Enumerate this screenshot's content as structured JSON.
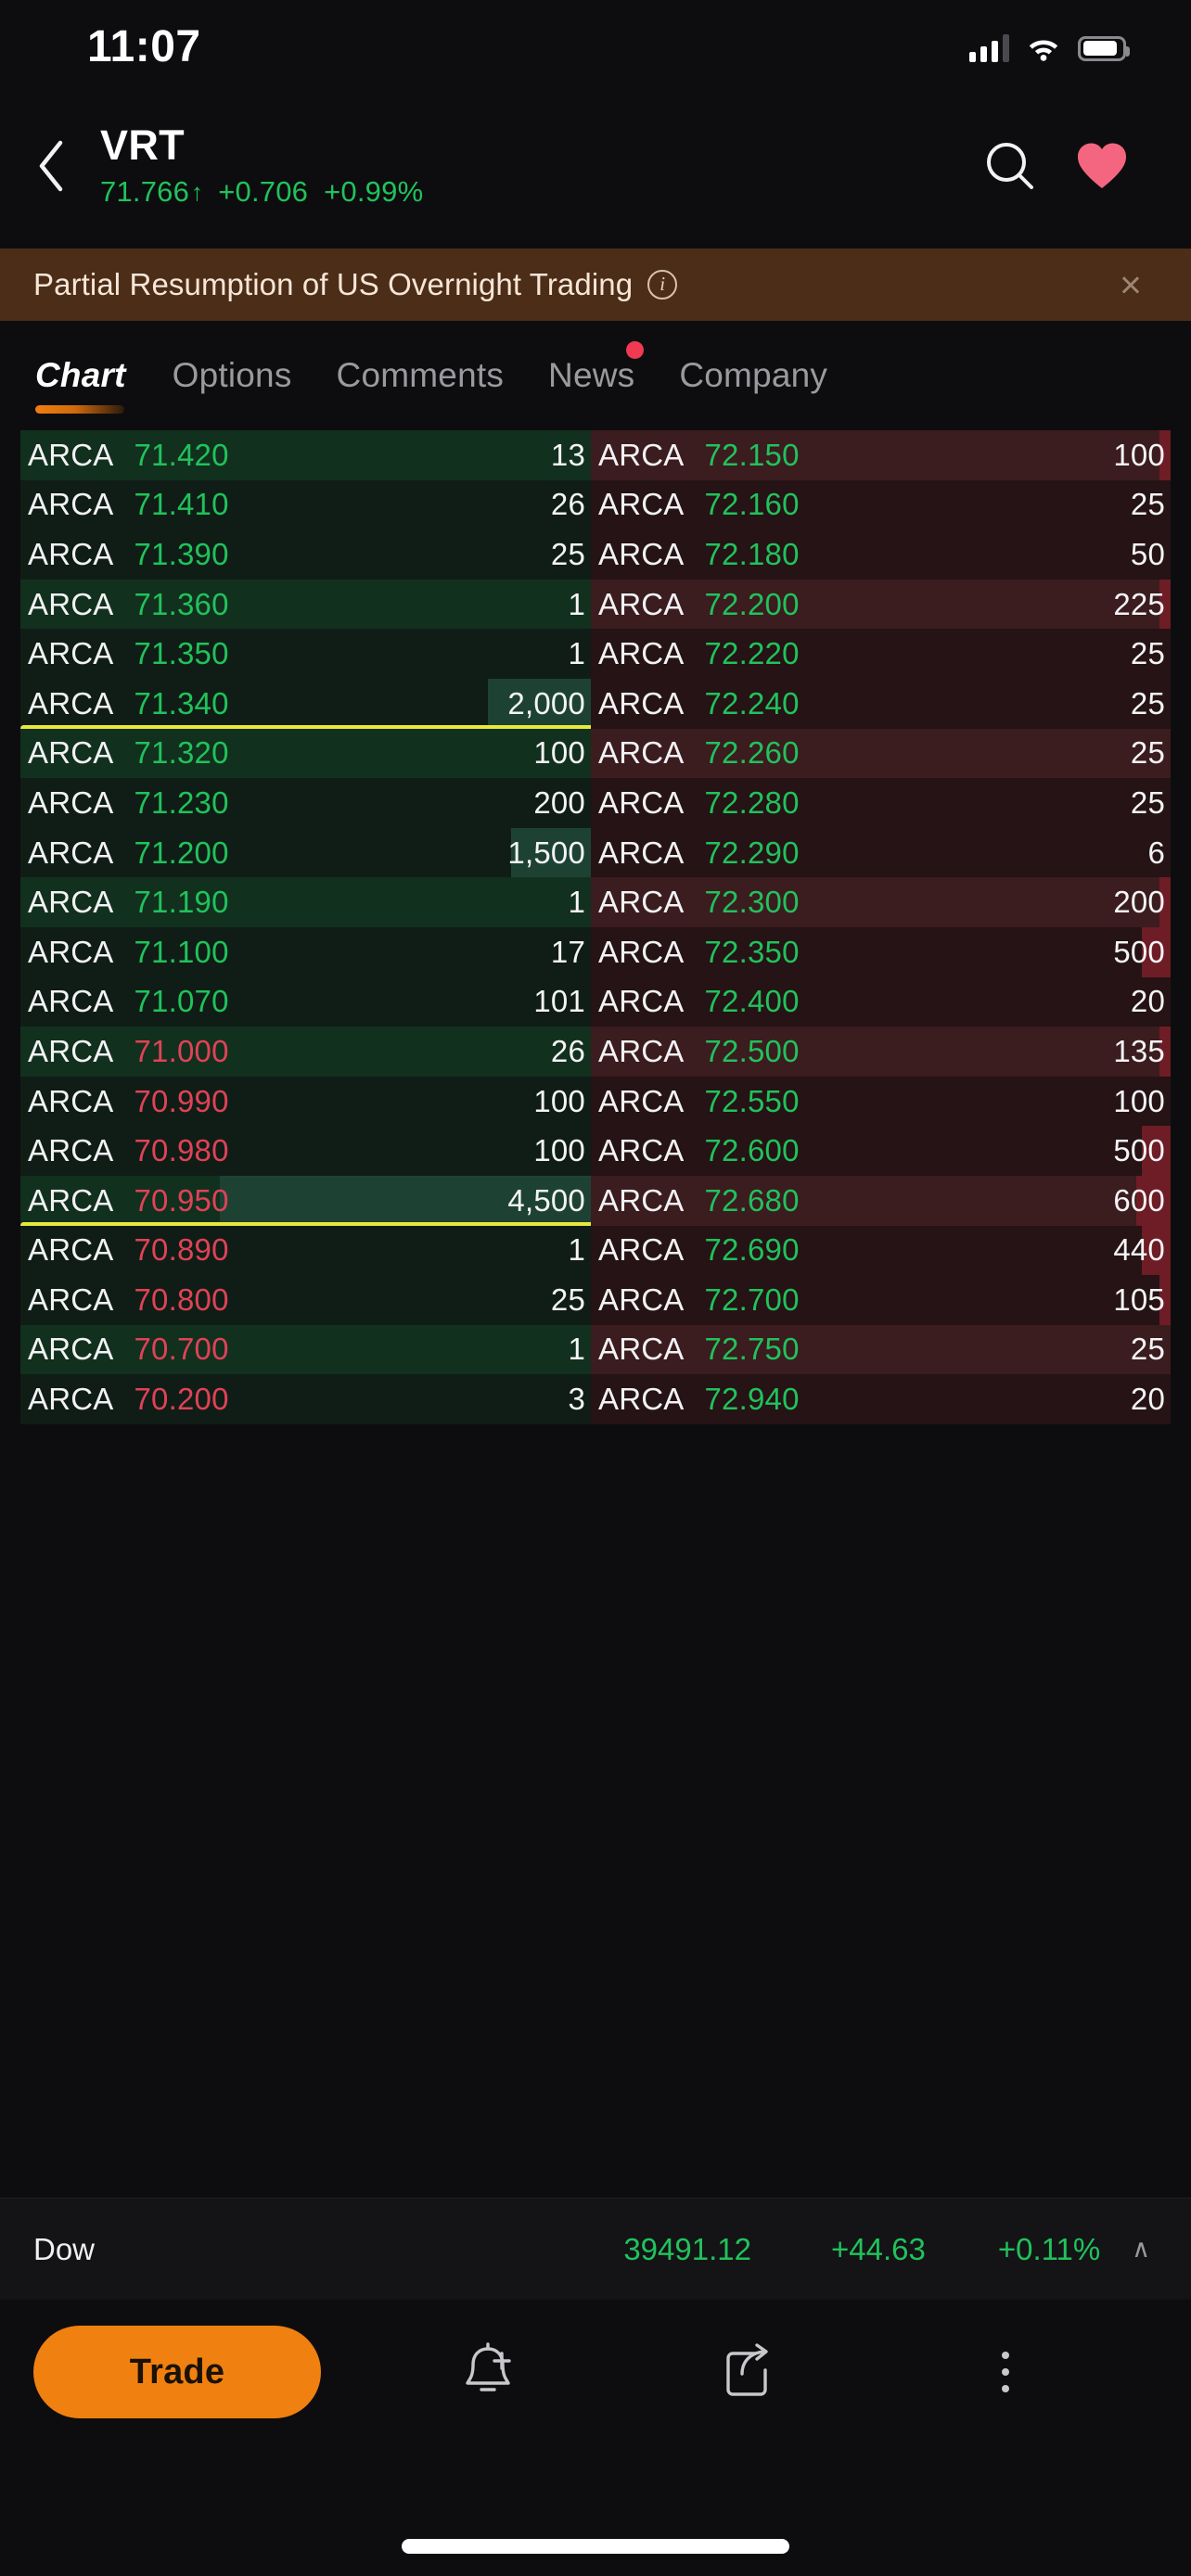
{
  "status_bar": {
    "time": "11:07",
    "signal_icon": "cellular-bars-icon",
    "wifi_icon": "wifi-icon",
    "battery_icon": "battery-icon"
  },
  "header": {
    "back_icon": "back-chevron-icon",
    "symbol": "VRT",
    "last_price": "71.766",
    "arrow": "↑",
    "change": "+0.706",
    "change_percent": "+0.99%",
    "search_icon": "search-icon",
    "favorite_icon": "heart-icon",
    "up_color": "#21c25c"
  },
  "banner": {
    "text": "Partial Resumption of US Overnight Trading",
    "info_icon": "info-icon",
    "info_glyph": "i",
    "close_icon": "close-icon",
    "close_glyph": "×",
    "background": "#4c2d18"
  },
  "tabs": {
    "items": [
      {
        "label": "Chart",
        "active": true,
        "badge": false
      },
      {
        "label": "Options",
        "active": false,
        "badge": false
      },
      {
        "label": "Comments",
        "active": false,
        "badge": false
      },
      {
        "label": "News",
        "active": false,
        "badge": true
      },
      {
        "label": "Company",
        "active": false,
        "badge": false
      }
    ],
    "active_underline_color": "#f07d10",
    "badge_color": "#f03a52"
  },
  "order_book": {
    "bids": [
      {
        "mm": "ARCA",
        "price": "71.420",
        "size": "13",
        "dir": "up",
        "depth_pct": 0,
        "shade": "a"
      },
      {
        "mm": "ARCA",
        "price": "71.410",
        "size": "26",
        "dir": "up",
        "depth_pct": 0,
        "shade": "b"
      },
      {
        "mm": "ARCA",
        "price": "71.390",
        "size": "25",
        "dir": "up",
        "depth_pct": 0,
        "shade": "b"
      },
      {
        "mm": "ARCA",
        "price": "71.360",
        "size": "1",
        "dir": "up",
        "depth_pct": 0,
        "shade": "a"
      },
      {
        "mm": "ARCA",
        "price": "71.350",
        "size": "1",
        "dir": "up",
        "depth_pct": 0,
        "shade": "b"
      },
      {
        "mm": "ARCA",
        "price": "71.340",
        "size": "2,000",
        "dir": "up",
        "depth_pct": 18,
        "shade": "b",
        "divider": true
      },
      {
        "mm": "ARCA",
        "price": "71.320",
        "size": "100",
        "dir": "up",
        "depth_pct": 0,
        "shade": "a"
      },
      {
        "mm": "ARCA",
        "price": "71.230",
        "size": "200",
        "dir": "up",
        "depth_pct": 0,
        "shade": "b"
      },
      {
        "mm": "ARCA",
        "price": "71.200",
        "size": "1,500",
        "dir": "up",
        "depth_pct": 14,
        "shade": "b"
      },
      {
        "mm": "ARCA",
        "price": "71.190",
        "size": "1",
        "dir": "up",
        "depth_pct": 0,
        "shade": "a"
      },
      {
        "mm": "ARCA",
        "price": "71.100",
        "size": "17",
        "dir": "up",
        "depth_pct": 0,
        "shade": "b"
      },
      {
        "mm": "ARCA",
        "price": "71.070",
        "size": "101",
        "dir": "up",
        "depth_pct": 0,
        "shade": "b"
      },
      {
        "mm": "ARCA",
        "price": "71.000",
        "size": "26",
        "dir": "down",
        "depth_pct": 0,
        "shade": "a"
      },
      {
        "mm": "ARCA",
        "price": "70.990",
        "size": "100",
        "dir": "down",
        "depth_pct": 0,
        "shade": "b"
      },
      {
        "mm": "ARCA",
        "price": "70.980",
        "size": "100",
        "dir": "down",
        "depth_pct": 0,
        "shade": "b"
      },
      {
        "mm": "ARCA",
        "price": "70.950",
        "size": "4,500",
        "dir": "down",
        "depth_pct": 65,
        "shade": "a",
        "divider": true
      },
      {
        "mm": "ARCA",
        "price": "70.890",
        "size": "1",
        "dir": "down",
        "depth_pct": 0,
        "shade": "b"
      },
      {
        "mm": "ARCA",
        "price": "70.800",
        "size": "25",
        "dir": "down",
        "depth_pct": 0,
        "shade": "b"
      },
      {
        "mm": "ARCA",
        "price": "70.700",
        "size": "1",
        "dir": "down",
        "depth_pct": 0,
        "shade": "a"
      },
      {
        "mm": "ARCA",
        "price": "70.200",
        "size": "3",
        "dir": "down",
        "depth_pct": 0,
        "shade": "b"
      }
    ],
    "asks": [
      {
        "mm": "ARCA",
        "price": "72.150",
        "size": "100",
        "dir": "up",
        "depth_pct": 2,
        "shade": "a"
      },
      {
        "mm": "ARCA",
        "price": "72.160",
        "size": "25",
        "dir": "up",
        "depth_pct": 0,
        "shade": "b"
      },
      {
        "mm": "ARCA",
        "price": "72.180",
        "size": "50",
        "dir": "up",
        "depth_pct": 0,
        "shade": "b"
      },
      {
        "mm": "ARCA",
        "price": "72.200",
        "size": "225",
        "dir": "up",
        "depth_pct": 2,
        "shade": "a"
      },
      {
        "mm": "ARCA",
        "price": "72.220",
        "size": "25",
        "dir": "up",
        "depth_pct": 0,
        "shade": "b"
      },
      {
        "mm": "ARCA",
        "price": "72.240",
        "size": "25",
        "dir": "up",
        "depth_pct": 0,
        "shade": "b"
      },
      {
        "mm": "ARCA",
        "price": "72.260",
        "size": "25",
        "dir": "up",
        "depth_pct": 0,
        "shade": "a"
      },
      {
        "mm": "ARCA",
        "price": "72.280",
        "size": "25",
        "dir": "up",
        "depth_pct": 0,
        "shade": "b"
      },
      {
        "mm": "ARCA",
        "price": "72.290",
        "size": "6",
        "dir": "up",
        "depth_pct": 0,
        "shade": "b"
      },
      {
        "mm": "ARCA",
        "price": "72.300",
        "size": "200",
        "dir": "up",
        "depth_pct": 2,
        "shade": "a"
      },
      {
        "mm": "ARCA",
        "price": "72.350",
        "size": "500",
        "dir": "up",
        "depth_pct": 5,
        "shade": "b"
      },
      {
        "mm": "ARCA",
        "price": "72.400",
        "size": "20",
        "dir": "up",
        "depth_pct": 0,
        "shade": "b"
      },
      {
        "mm": "ARCA",
        "price": "72.500",
        "size": "135",
        "dir": "up",
        "depth_pct": 2,
        "shade": "a"
      },
      {
        "mm": "ARCA",
        "price": "72.550",
        "size": "100",
        "dir": "up",
        "depth_pct": 0,
        "shade": "b"
      },
      {
        "mm": "ARCA",
        "price": "72.600",
        "size": "500",
        "dir": "up",
        "depth_pct": 5,
        "shade": "b"
      },
      {
        "mm": "ARCA",
        "price": "72.680",
        "size": "600",
        "dir": "up",
        "depth_pct": 6,
        "shade": "a"
      },
      {
        "mm": "ARCA",
        "price": "72.690",
        "size": "440",
        "dir": "up",
        "depth_pct": 5,
        "shade": "b"
      },
      {
        "mm": "ARCA",
        "price": "72.700",
        "size": "105",
        "dir": "up",
        "depth_pct": 2,
        "shade": "b"
      },
      {
        "mm": "ARCA",
        "price": "72.750",
        "size": "25",
        "dir": "up",
        "depth_pct": 0,
        "shade": "a"
      },
      {
        "mm": "ARCA",
        "price": "72.940",
        "size": "20",
        "dir": "up",
        "depth_pct": 0,
        "shade": "b"
      }
    ],
    "divider_color": "#e9e93c",
    "bid_color": "#21c25c",
    "ask_color": "#e04257"
  },
  "index_ticker": {
    "name": "Dow",
    "value": "39491.12",
    "change": "+44.63",
    "change_percent": "+0.11%",
    "caret_icon": "chevron-up-icon",
    "caret_glyph": "∧",
    "color": "#21c25c"
  },
  "bottom_bar": {
    "trade_label": "Trade",
    "trade_color": "#f08010",
    "alert_icon": "bell-plus-icon",
    "share_icon": "share-icon",
    "more_icon": "more-vertical-icon",
    "home_indicator": "home-indicator"
  }
}
